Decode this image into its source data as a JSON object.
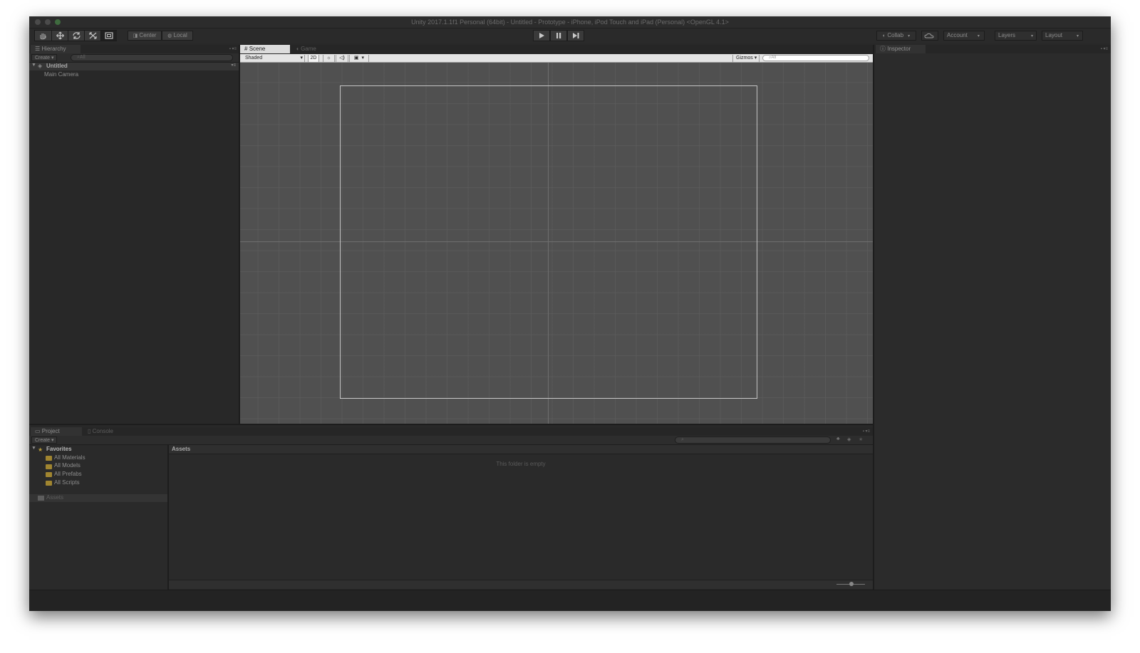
{
  "window": {
    "title": "Unity 2017.1.1f1 Personal (64bit) - Untitled - Prototype - iPhone, iPod Touch and iPad (Personal) <OpenGL 4.1>"
  },
  "toolbar": {
    "transform_tools": [
      "hand-icon",
      "move-icon",
      "rotate-icon",
      "scale-icon",
      "rect-icon"
    ],
    "pivot_label": "Center",
    "space_label": "Local",
    "playback": [
      "play-icon",
      "pause-icon",
      "step-icon"
    ],
    "collab_label": "Collab",
    "account_label": "Account",
    "layers_label": "Layers",
    "layout_label": "Layout"
  },
  "hierarchy": {
    "tab_label": "Hierarchy",
    "create_label": "Create",
    "search_placeholder": "All",
    "scene_name": "Untitled",
    "items": [
      "Main Camera"
    ]
  },
  "scene": {
    "tabs": [
      {
        "label": "Scene",
        "icon": "grid-icon"
      },
      {
        "label": "Game",
        "icon": "pacman-icon"
      }
    ],
    "draw_mode": "Shaded",
    "mode_2d_label": "2D",
    "gizmos_label": "Gizmos",
    "search_placeholder": "All"
  },
  "inspector": {
    "tab_label": "Inspector"
  },
  "project": {
    "tabs": [
      "Project",
      "Console"
    ],
    "create_label": "Create",
    "favorites_label": "Favorites",
    "favorites": [
      "All Materials",
      "All Models",
      "All Prefabs",
      "All Scripts"
    ],
    "assets_folder": "Assets",
    "assets_header": "Assets",
    "empty_message": "This folder is empty"
  },
  "colors": {
    "window_bg": "#282828",
    "scene_bg": "#505050",
    "active_tab": "#dcdcdc",
    "folder": "#a08530"
  }
}
